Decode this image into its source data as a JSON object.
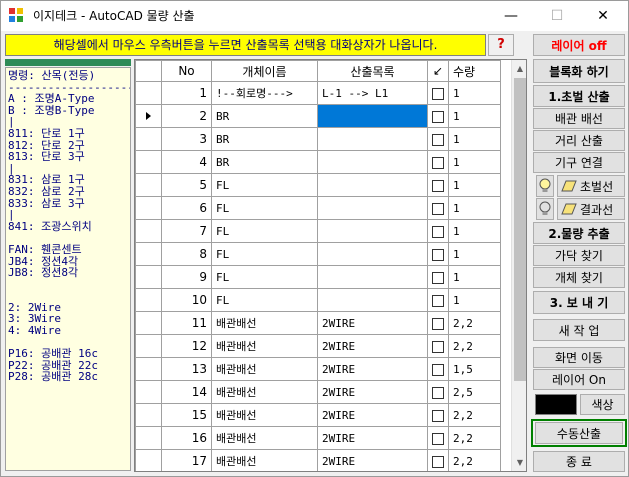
{
  "window": {
    "title": "이지테크 - AutoCAD 물량 산출",
    "minimize_glyph": "—",
    "maximize_glyph": "☐",
    "close_glyph": "✕"
  },
  "hint": {
    "text": "해당셀에서 마우스 우측버튼을 누르면 산출목록 선택용 대화상자가 나옵니다.",
    "help_label": "?"
  },
  "legend_lines": [
    "명령: 산목(전등)",
    "--------------------",
    "A : 조명A-Type",
    "B : 조명B-Type",
    "|",
    "811: 단로 1구",
    "812: 단로 2구",
    "813: 단로 3구",
    "|",
    "831: 삼로 1구",
    "832: 삼로 2구",
    "833: 삼로 3구",
    "|",
    "841: 조광스위치",
    "",
    "FAN: 휀콘센트",
    "JB4: 정션4각",
    "JB8: 정션8각",
    "",
    "",
    "2: 2Wire",
    "3: 3Wire",
    "4: 4Wire",
    "",
    "P16: 공배관 16c",
    "P22: 공배관 22c",
    "P28: 공배관 28c"
  ],
  "grid": {
    "headers": {
      "no": "No",
      "name": "개체이름",
      "list": "산출목록",
      "check": "↙",
      "qty": "수량"
    },
    "rows": [
      {
        "no": "1",
        "name": "!--회로명--->",
        "list": "L-1 --> L1",
        "qty": "1",
        "current": false,
        "selected_list": false
      },
      {
        "no": "2",
        "name": "BR",
        "list": "",
        "qty": "1",
        "current": true,
        "selected_list": true
      },
      {
        "no": "3",
        "name": "BR",
        "list": "",
        "qty": "1",
        "current": false,
        "selected_list": false
      },
      {
        "no": "4",
        "name": "BR",
        "list": "",
        "qty": "1",
        "current": false,
        "selected_list": false
      },
      {
        "no": "5",
        "name": "FL",
        "list": "",
        "qty": "1",
        "current": false,
        "selected_list": false
      },
      {
        "no": "6",
        "name": "FL",
        "list": "",
        "qty": "1",
        "current": false,
        "selected_list": false
      },
      {
        "no": "7",
        "name": "FL",
        "list": "",
        "qty": "1",
        "current": false,
        "selected_list": false
      },
      {
        "no": "8",
        "name": "FL",
        "list": "",
        "qty": "1",
        "current": false,
        "selected_list": false
      },
      {
        "no": "9",
        "name": "FL",
        "list": "",
        "qty": "1",
        "current": false,
        "selected_list": false
      },
      {
        "no": "10",
        "name": "FL",
        "list": "",
        "qty": "1",
        "current": false,
        "selected_list": false
      },
      {
        "no": "11",
        "name": "배관배선",
        "list": "2WIRE",
        "qty": "2,2",
        "current": false,
        "selected_list": false
      },
      {
        "no": "12",
        "name": "배관배선",
        "list": "2WIRE",
        "qty": "2,2",
        "current": false,
        "selected_list": false
      },
      {
        "no": "13",
        "name": "배관배선",
        "list": "2WIRE",
        "qty": "1,5",
        "current": false,
        "selected_list": false
      },
      {
        "no": "14",
        "name": "배관배선",
        "list": "2WIRE",
        "qty": "2,5",
        "current": false,
        "selected_list": false
      },
      {
        "no": "15",
        "name": "배관배선",
        "list": "2WIRE",
        "qty": "2,2",
        "current": false,
        "selected_list": false
      },
      {
        "no": "16",
        "name": "배관배선",
        "list": "2WIRE",
        "qty": "2,2",
        "current": false,
        "selected_list": false
      },
      {
        "no": "17",
        "name": "배관배선",
        "list": "2WIRE",
        "qty": "2,2",
        "current": false,
        "selected_list": false
      }
    ]
  },
  "right_panel": {
    "layer_off": "레이어 off",
    "block": "블록화 하기",
    "step1": "1.초벌 산출",
    "pipe_wire": "배관 배선",
    "distance": "거리 산출",
    "fixture_connect": "기구 연결",
    "draft_line": "초벌선",
    "result_line": "결과선",
    "step2": "2.물량 추출",
    "find_branch": "가닥 찾기",
    "find_object": "개체 찾기",
    "step3": "3. 보 내 기",
    "new_work": "새 작 업",
    "screen_move": "화면 이동",
    "layer_on": "레이어 On",
    "color": "색상",
    "manual": "수동산출",
    "exit": "종 료"
  },
  "colors": {
    "hint_bg": "#ffff00",
    "accent_red": "#ff0000",
    "selection": "#0078d7",
    "manual_border": "#008000",
    "swatch": "#000000"
  }
}
